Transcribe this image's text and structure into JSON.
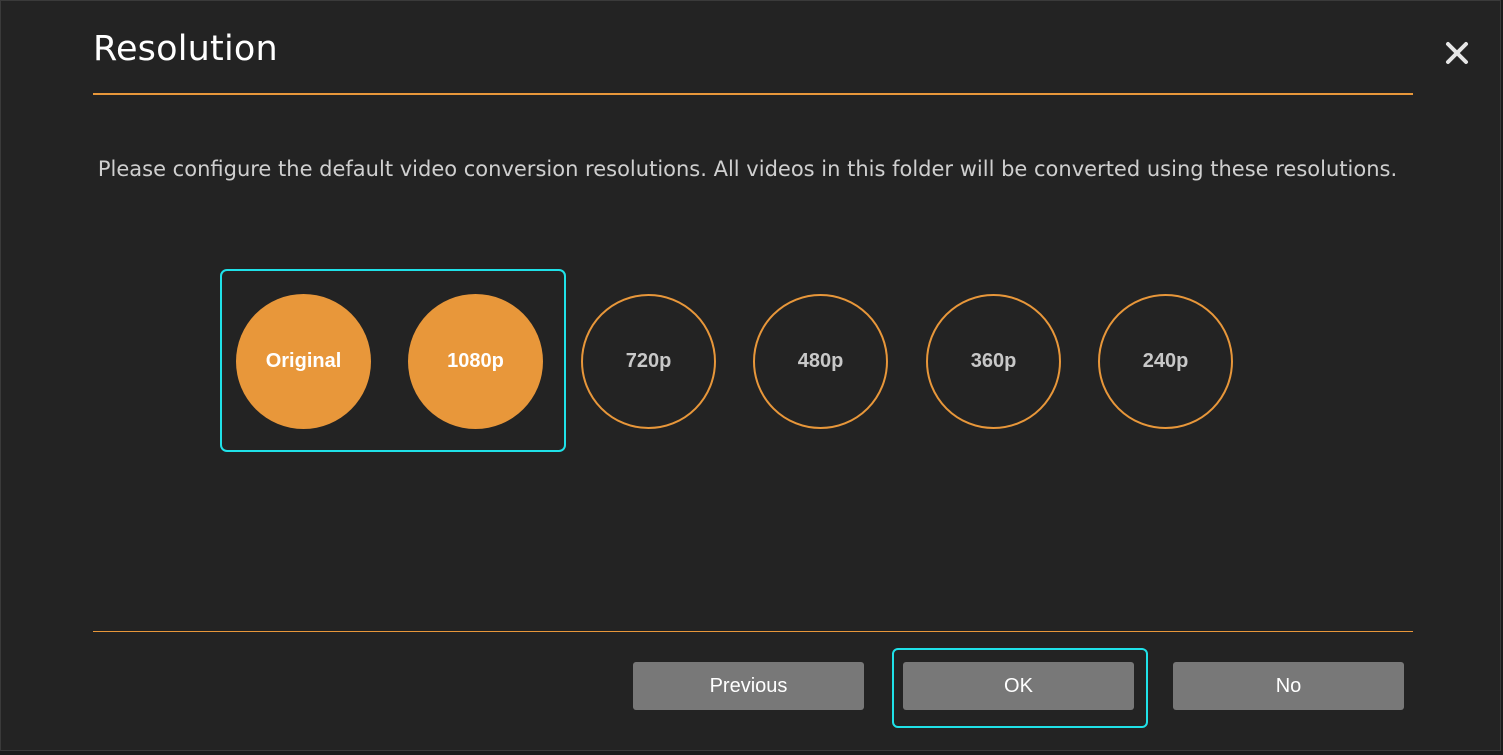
{
  "dialog": {
    "title": "Resolution",
    "description": "Please configure the default video conversion resolutions. All videos in this folder will be converted using these resolutions."
  },
  "resolutions": [
    {
      "label": "Original",
      "selected": true
    },
    {
      "label": "1080p",
      "selected": true
    },
    {
      "label": "720p",
      "selected": false
    },
    {
      "label": "480p",
      "selected": false
    },
    {
      "label": "360p",
      "selected": false
    },
    {
      "label": "240p",
      "selected": false
    }
  ],
  "buttons": {
    "previous": "Previous",
    "ok": "OK",
    "no": "No"
  },
  "icons": {
    "close": "close-icon"
  },
  "colors": {
    "accent": "#e8973a",
    "focus": "#1fe1e8",
    "background": "#232323",
    "button": "#787878"
  }
}
